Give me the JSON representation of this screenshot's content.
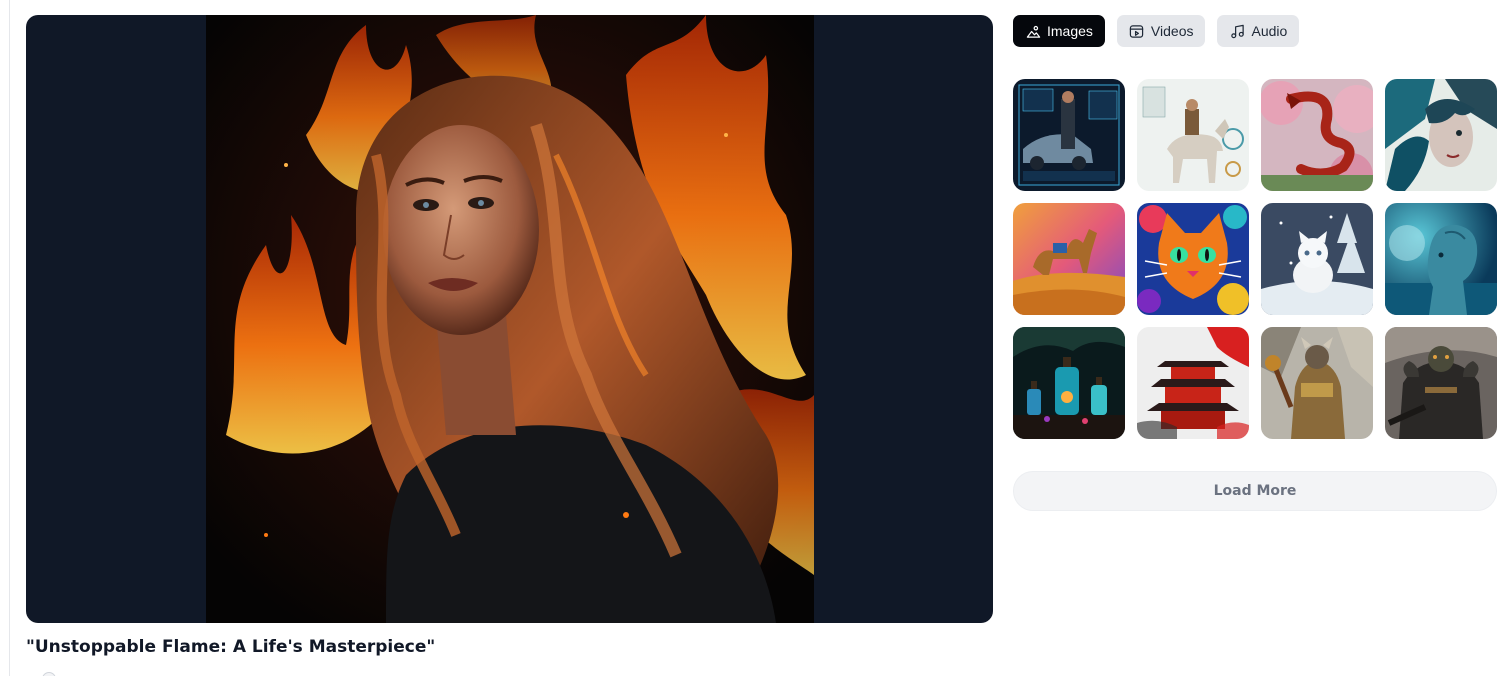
{
  "viewer": {
    "title": "\"Unstoppable Flame: A Life's Masterpiece\"",
    "background": "#101827"
  },
  "tabs": [
    {
      "label": "Images",
      "icon": "image-icon",
      "active": true
    },
    {
      "label": "Videos",
      "icon": "video-icon",
      "active": false
    },
    {
      "label": "Audio",
      "icon": "music-note-icon",
      "active": false
    }
  ],
  "gallery": {
    "thumbnails": [
      {
        "subject": "cyberpunk-car-interface"
      },
      {
        "subject": "knight-on-horse-infographic"
      },
      {
        "subject": "red-dragon-cherry-blossoms"
      },
      {
        "subject": "teal-splash-portrait"
      },
      {
        "subject": "camel-in-desert-sunset"
      },
      {
        "subject": "psychedelic-cat"
      },
      {
        "subject": "white-kitten-in-snow"
      },
      {
        "subject": "blue-alien-ocean"
      },
      {
        "subject": "glowing-potion-bottles"
      },
      {
        "subject": "red-pagoda-ink-splash"
      },
      {
        "subject": "armored-warrior-ruins"
      },
      {
        "subject": "dark-armored-orc"
      }
    ],
    "load_more_label": "Load More"
  },
  "colors": {
    "active_tab": "#05070c",
    "inactive_tab": "#e5e7eb",
    "load_more_bg": "#f3f4f6"
  }
}
